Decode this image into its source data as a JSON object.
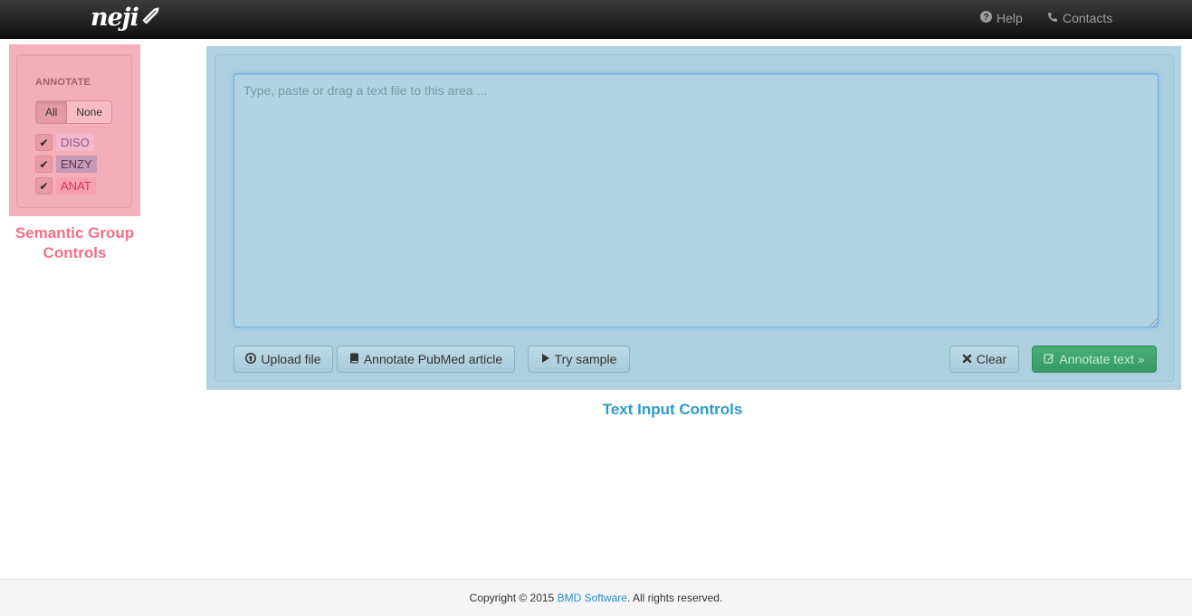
{
  "navbar": {
    "brand": "neji",
    "help_label": "Help",
    "contacts_label": "Contacts"
  },
  "semantic_panel": {
    "heading": "ANNOTATE",
    "all_label": "All",
    "none_label": "None",
    "groups": [
      {
        "label": "DISO",
        "checked": true,
        "color": "#f2b9cd"
      },
      {
        "label": "ENZY",
        "checked": true,
        "color": "#c99ab7"
      },
      {
        "label": "ANAT",
        "checked": true,
        "color": "#f8a0b0"
      }
    ],
    "check_mark": "✔",
    "caption_line1": "Semantic Group",
    "caption_line2": "Controls"
  },
  "text_panel": {
    "placeholder": "Type, paste or drag a text file to this area ...",
    "upload_label": "Upload file",
    "pubmed_label": "Annotate PubMed article",
    "sample_label": "Try sample",
    "clear_label": "Clear",
    "annotate_label": "Annotate text »",
    "caption": "Text Input Controls"
  },
  "footer": {
    "prefix": "Copyright © 2015 ",
    "company": "BMD Software",
    "suffix": ". All rights reserved."
  },
  "colors": {
    "semantic_overlay": "#f5b1bb",
    "text_overlay": "#b3d2e1",
    "annotate_button": "#3fa56c",
    "semantic_caption": "#f07188",
    "text_caption": "#2b9bc8"
  }
}
